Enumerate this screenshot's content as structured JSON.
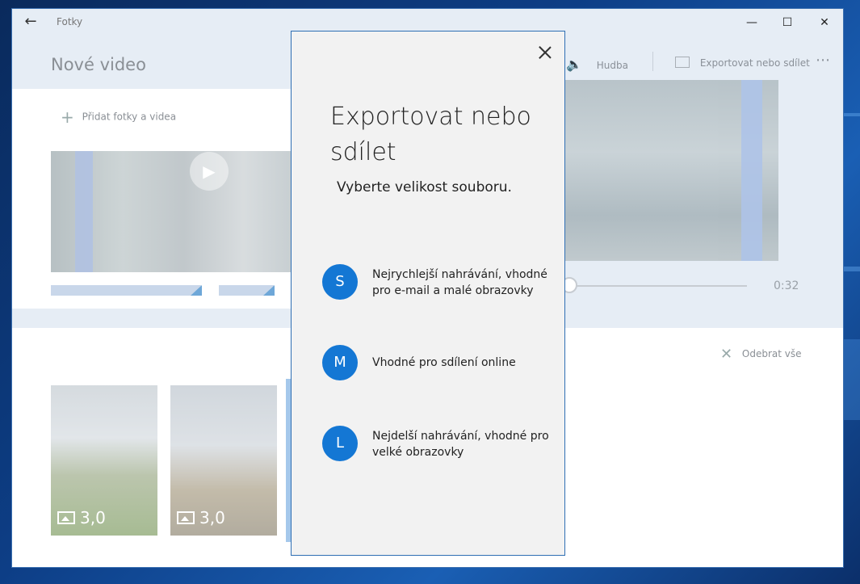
{
  "window": {
    "app_title": "Fotky",
    "back_glyph": "←",
    "minimize_glyph": "—",
    "maximize_glyph": "☐",
    "close_glyph": "✕"
  },
  "header": {
    "page_title": "Nové video",
    "music_label": "Hudba",
    "export_label": "Exportovat nebo sdílet",
    "more_glyph": "⋯"
  },
  "library": {
    "add_label": "Přidat fotky a videa"
  },
  "preview": {
    "duration": "0:32"
  },
  "storyboard": {
    "remove_all_label": "Odebrat vše",
    "cards": [
      {
        "duration": "3,0"
      },
      {
        "duration": "3,0"
      }
    ]
  },
  "dialog": {
    "title": "Exportovat nebo sdílet",
    "subtitle": "Vyberte velikost souboru.",
    "options": [
      {
        "letter": "S",
        "description": "Nejrychlejší nahrávání, vhodné pro e-mail a malé obrazovky"
      },
      {
        "letter": "M",
        "description": "Vhodné pro sdílení online"
      },
      {
        "letter": "L",
        "description": "Nejdelší nahrávání, vhodné pro velké obrazovky"
      }
    ]
  },
  "colors": {
    "accent": "#1477d4",
    "dialog_border": "#2f6fb4",
    "dialog_bg": "#f2f2f2",
    "app_band": "#e6edf5"
  }
}
